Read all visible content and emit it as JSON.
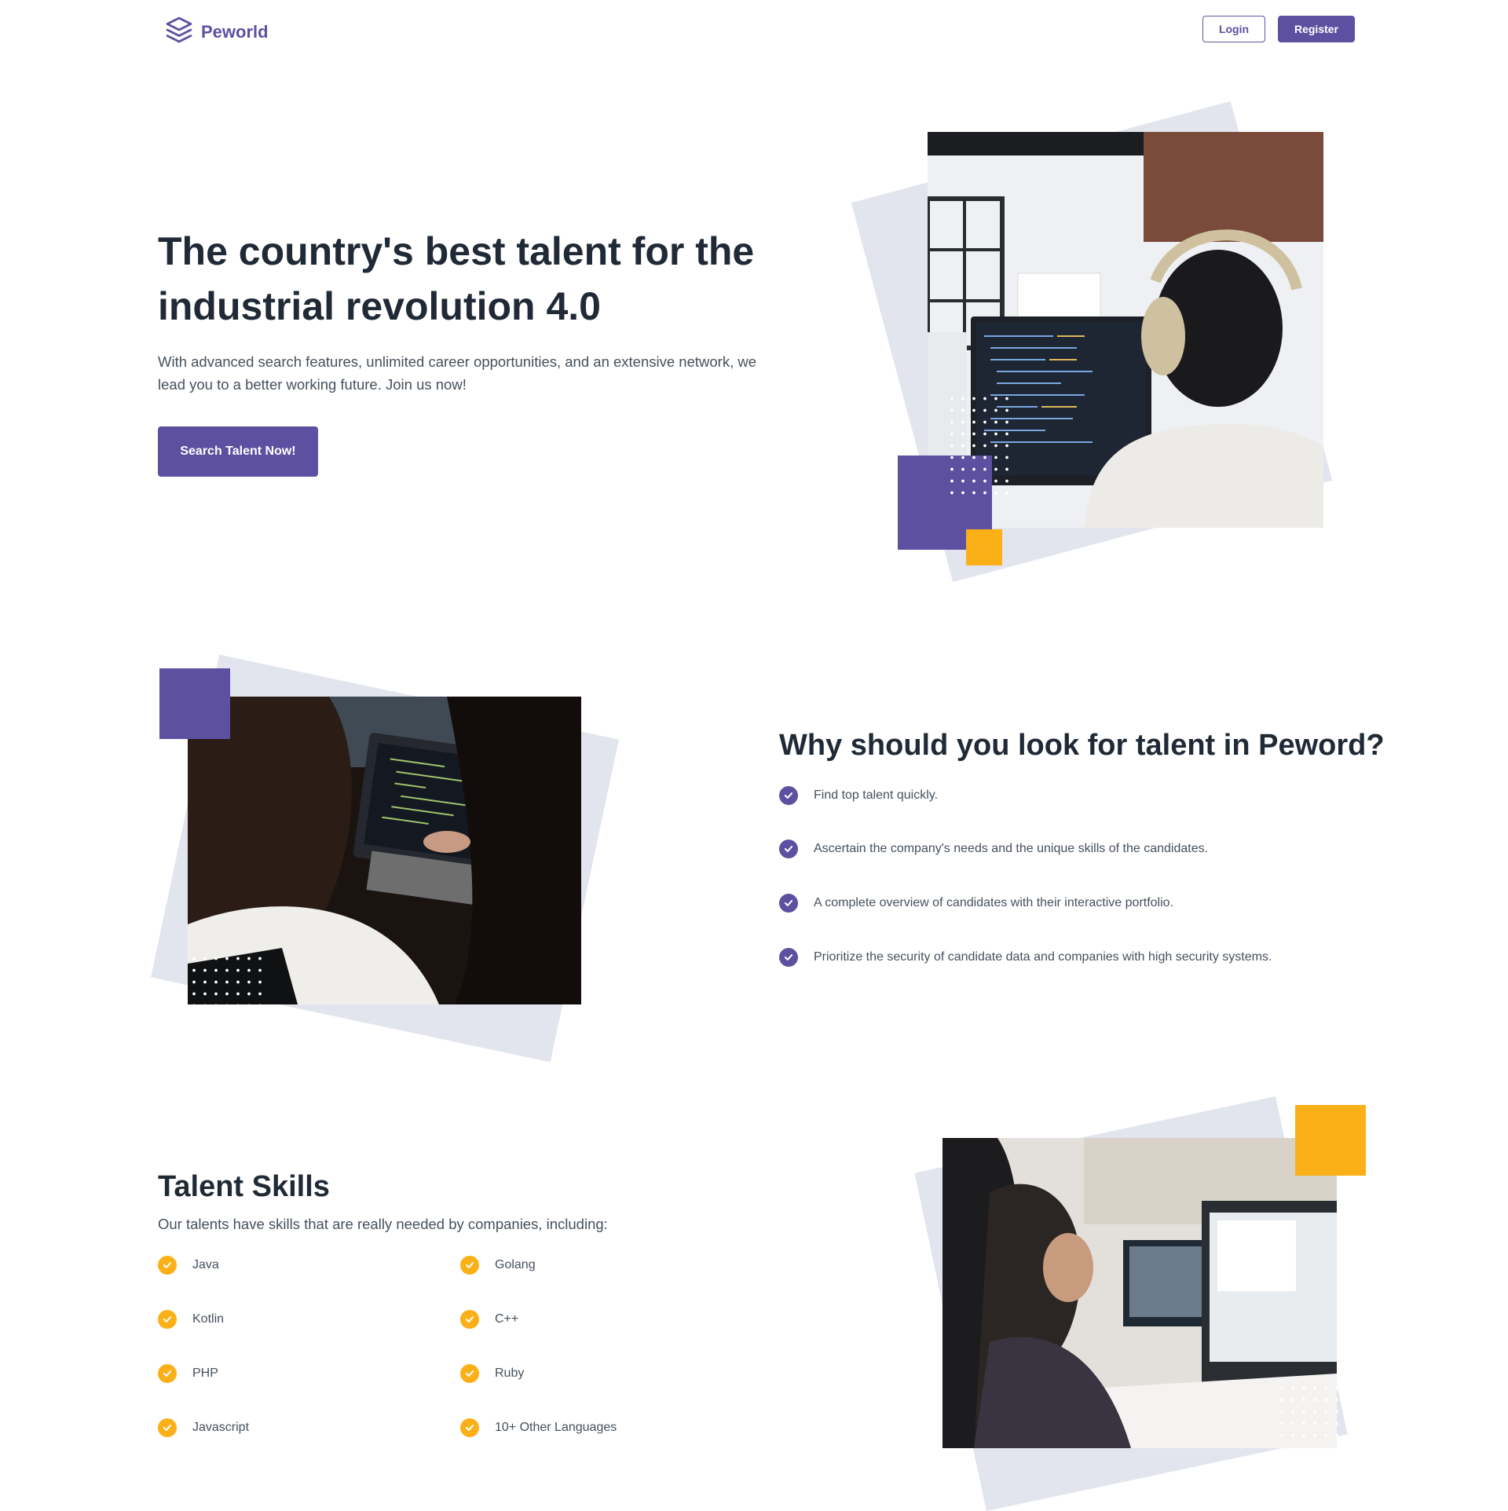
{
  "nav": {
    "brand": "Peworld",
    "login_label": "Login",
    "register_label": "Register"
  },
  "hero": {
    "title": "The country's best talent for the industrial revolution 4.0",
    "subtitle": "With advanced search features, unlimited career opportunities, and an extensive network, we lead you to a better working future. Join us now!",
    "cta_label": "Search Talent Now!"
  },
  "why": {
    "title": "Why should you look for talent in Peword?",
    "items": [
      "Find top talent quickly.",
      "Ascertain the company's needs and the unique skills of the candidates.",
      "A complete overview of candidates with their interactive portfolio.",
      "Prioritize the security of candidate data and companies with high security systems."
    ]
  },
  "skills": {
    "title": "Talent Skills",
    "subtitle": "Our talents have skills that are really needed by companies, including:",
    "left": [
      "Java",
      "Kotlin",
      "PHP",
      "Javascript"
    ],
    "right": [
      "Golang",
      "C++",
      "Ruby",
      "10+ Other Languages"
    ]
  },
  "colors": {
    "primary": "#5E50A1",
    "accent": "#FBB017",
    "text": "#1F2A36",
    "muted": "#46505C",
    "shape": "#E3E5EE"
  },
  "icons": {
    "brand": "layers-icon",
    "check": "check-circle-icon"
  }
}
